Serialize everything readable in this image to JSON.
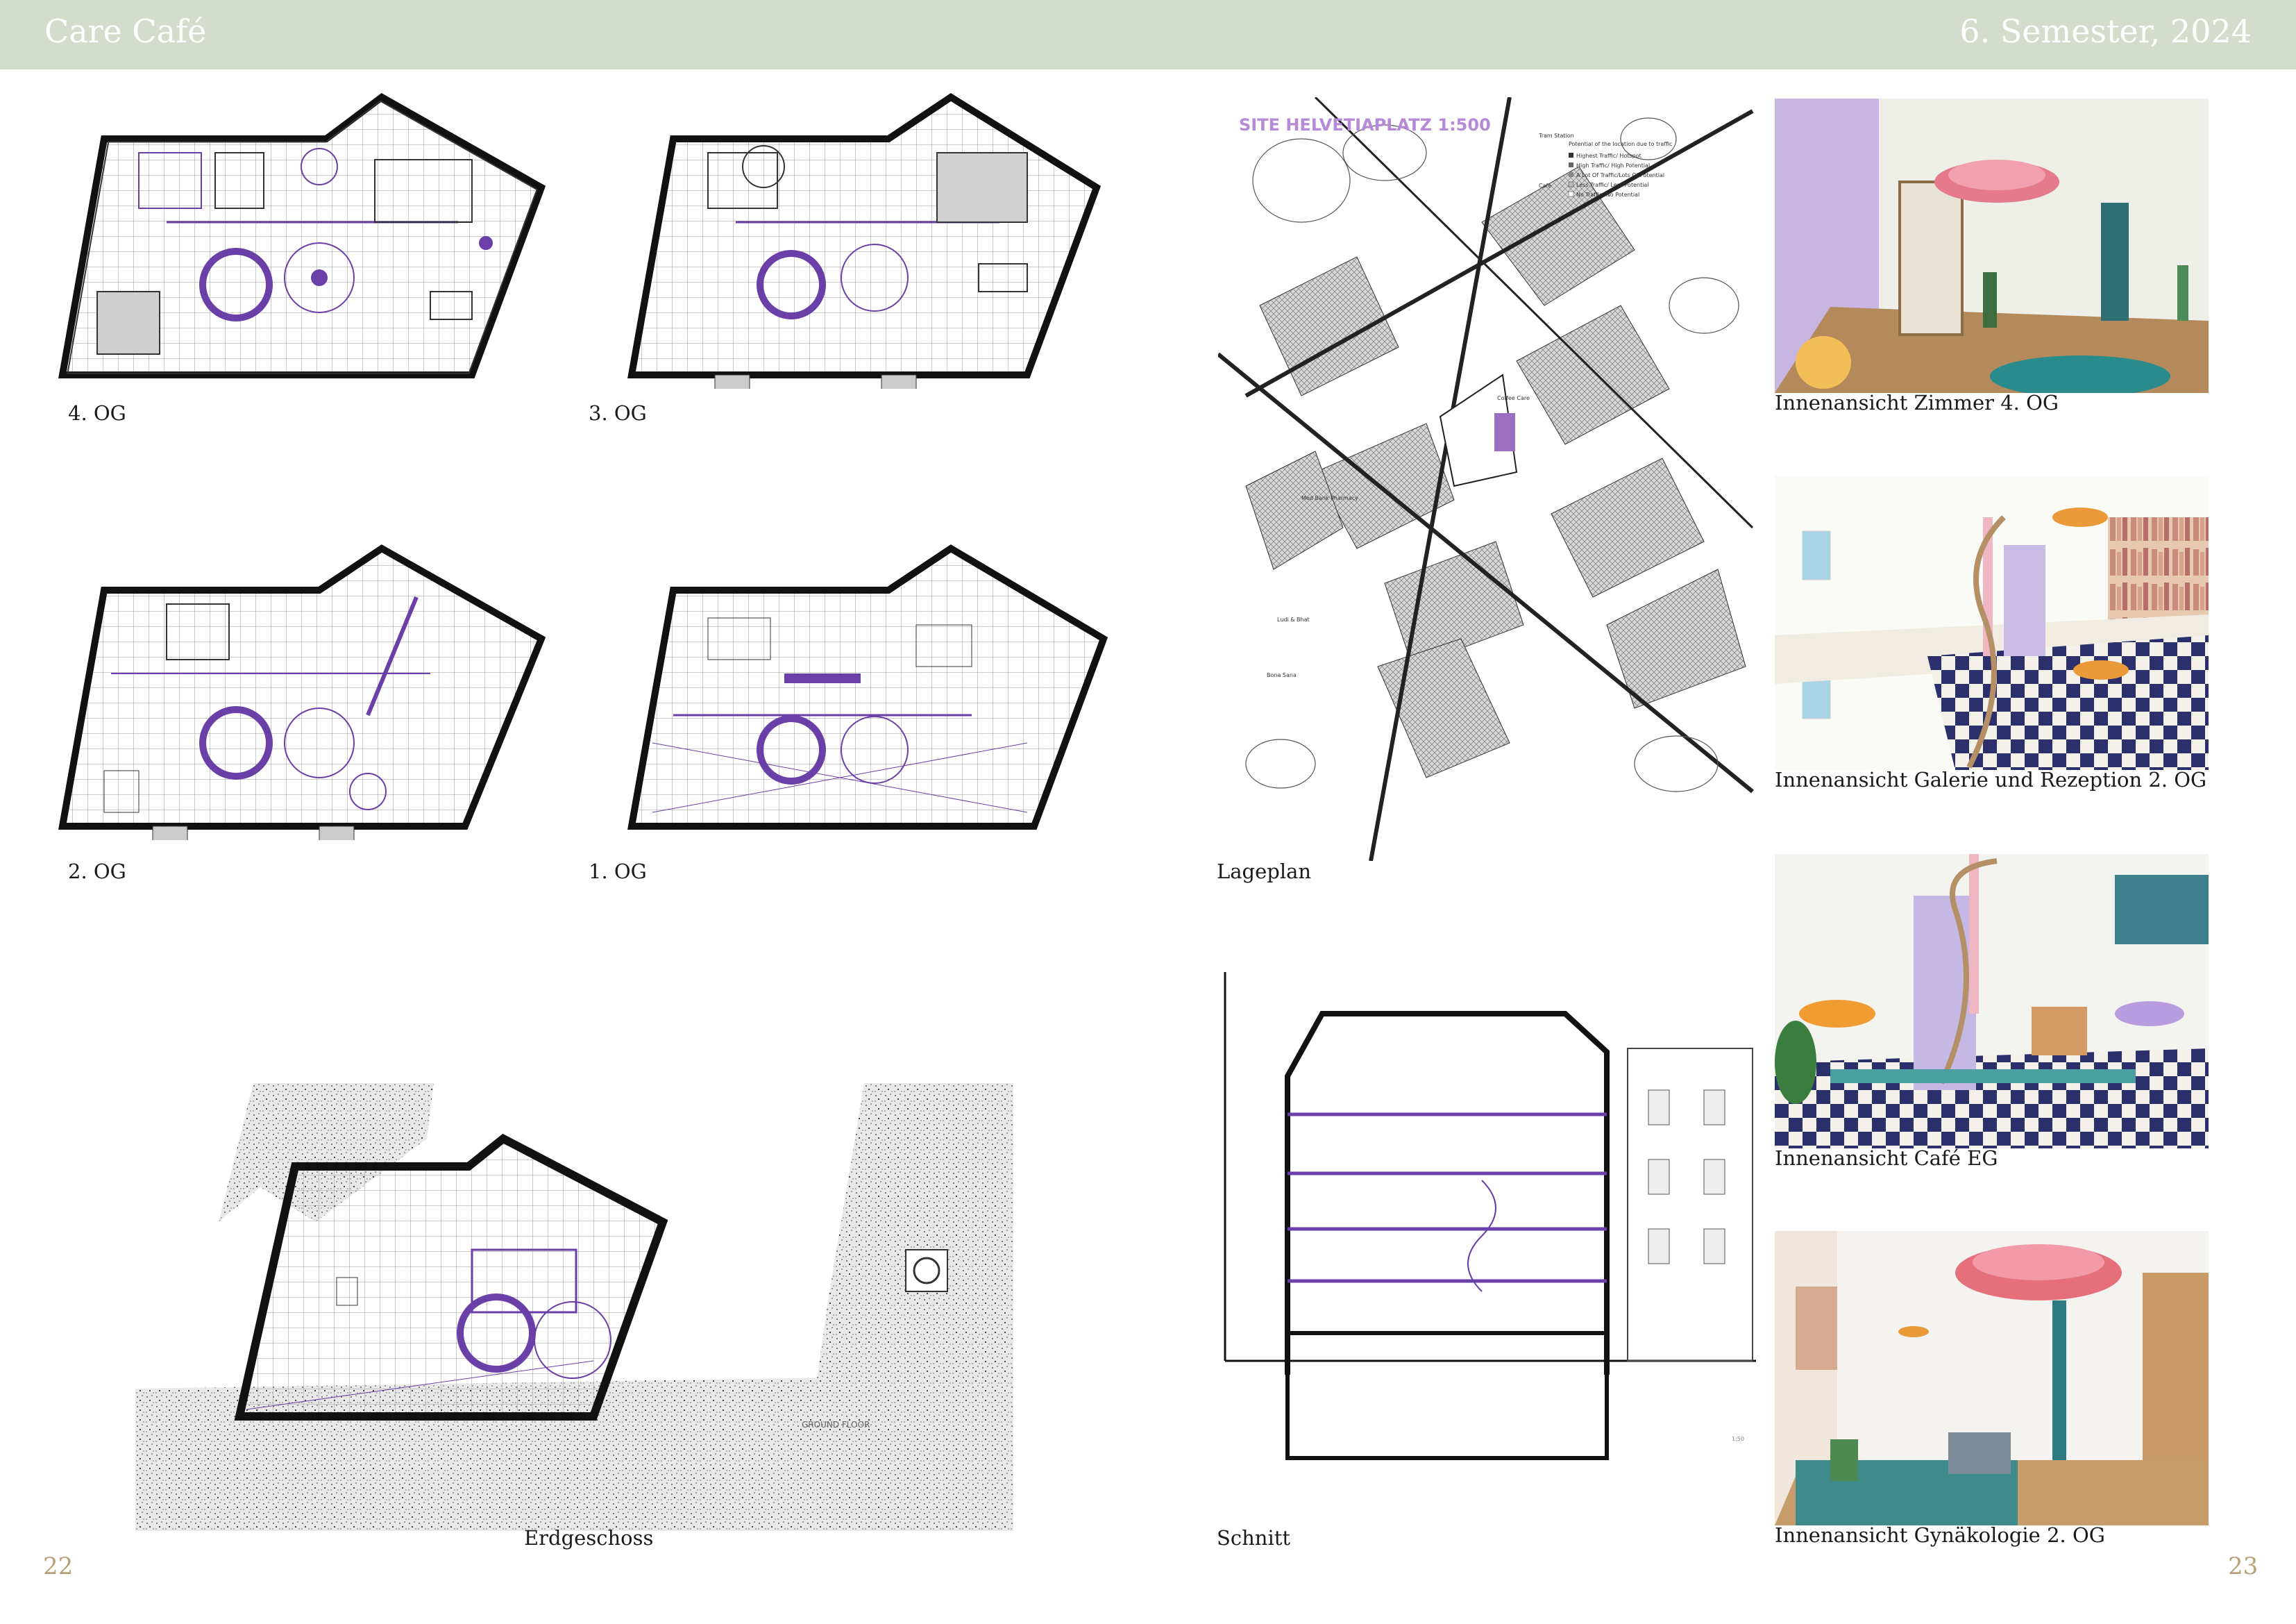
{
  "header": {
    "title": "Care Café",
    "semester": "6. Semester, 2024",
    "bar_color": "#d4ddcc"
  },
  "floor_plans": [
    {
      "id": "og4",
      "caption": "4. OG"
    },
    {
      "id": "og3",
      "caption": "3. OG"
    },
    {
      "id": "og2",
      "caption": "2. OG"
    },
    {
      "id": "og1",
      "caption": "1. OG"
    },
    {
      "id": "eg",
      "caption": "Erdgeschoss",
      "label": "GROUND FLOOR"
    }
  ],
  "site_plan": {
    "caption": "Lageplan",
    "title": "SITE HELVETIAPLATZ 1:500",
    "legend_title": "Potential of the location due to traffic",
    "legend": [
      "Highest Traffic/ Hotspot",
      "High Traffic/ High Potential",
      "A Lot Of Traffic/Lots Of Potential",
      "Less Traffic/ Less Potential",
      "No Traffic/ No Potential"
    ],
    "legend_icons": [
      "Tram Station",
      "Café"
    ],
    "labels": [
      "Coffee Care",
      "Med Bank Pharmacy",
      "Ludi & Bhat",
      "Bona Sana"
    ]
  },
  "section": {
    "caption": "Schnitt",
    "scale": "1:50"
  },
  "renders": [
    {
      "caption": "Innenansicht Zimmer 4. OG"
    },
    {
      "caption": "Innenansicht Galerie und Rezeption 2. OG"
    },
    {
      "caption": "Innenansicht Café EG"
    },
    {
      "caption": "Innenansicht Gynäkologie 2. OG"
    }
  ],
  "page_numbers": {
    "left": "22",
    "right": "23"
  },
  "colors": {
    "accent_purple": "#6a3fa8",
    "page_number": "#b8a078",
    "wall": "#111111"
  }
}
